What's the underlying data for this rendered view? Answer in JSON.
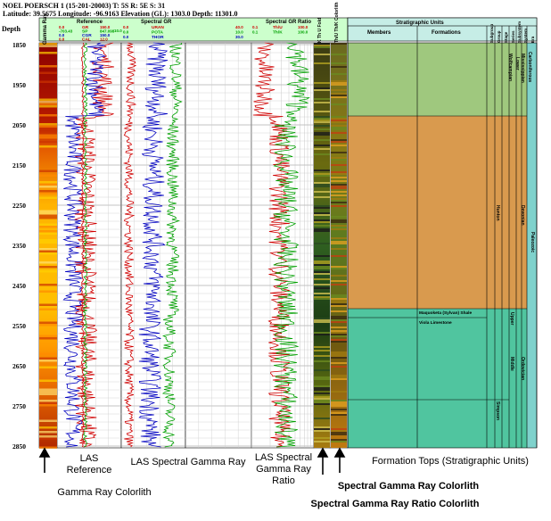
{
  "header": {
    "line1": "NOEL POERSCH 1 (15-201-20003) T: 5S R: 5E S: 31",
    "line2": "Latitude: 39.5675 Longitude: -96.9163 Elevation (GL): 1303.0 Depth: 11301.0"
  },
  "depth": {
    "label": "Depth",
    "ticks": [
      "1850",
      "1950",
      "2050",
      "2150",
      "2250",
      "2350",
      "2450",
      "2550",
      "2650",
      "2750",
      "2850"
    ]
  },
  "tracks": {
    "gr_colorlith": {
      "title": "Gamma Ray"
    },
    "reference": {
      "title": "Reference",
      "curves": [
        {
          "name": "GR",
          "min": "0.0",
          "max": "150.0",
          "color": "#d00000"
        },
        {
          "name": "SP",
          "min": "-703.43",
          "max": "847.098",
          "color": "#00a000"
        },
        {
          "name": "CGR",
          "min": "0.0",
          "max": "150.0",
          "color": "#0000c0"
        },
        {
          "name": "CAL",
          "min": "0.0",
          "max": "12.0",
          "color": "#d00000"
        }
      ],
      "extra_left": "10.0",
      "extra_right": "10.0"
    },
    "spectral_gr": {
      "title": "Spectral GR",
      "curves": [
        {
          "name": "URAN",
          "min": "0.0",
          "max": "40.0",
          "color": "#d00000"
        },
        {
          "name": "POTA",
          "min": "0.0",
          "max": "10.0",
          "color": "#00a000"
        },
        {
          "name": "THOR",
          "min": "0.0",
          "max": "30.0",
          "color": "#0000c0"
        }
      ]
    },
    "gr_ratio": {
      "title": "Spectral GR Ratio",
      "curves": [
        {
          "name": "Th/U",
          "min": "0.1",
          "max": "100.0",
          "color": "#d00000"
        },
        {
          "name": "Th/K",
          "min": "0.1",
          "max": "100.0",
          "color": "#00a000"
        }
      ]
    },
    "spectral_colorlith": {
      "title": "K Th U Fold"
    },
    "ratio_colorlith": {
      "title": "Th/U Th/K Colorlith"
    }
  },
  "strat": {
    "title": "Stratigraphic Units",
    "columns": [
      "Members",
      "Formations",
      "Subgroup",
      "Group",
      "Stage",
      "Series",
      "Subsystem",
      "System",
      "Era"
    ],
    "units": [
      {
        "name": "Wolfcampian",
        "col": "series"
      },
      {
        "name": "Lower",
        "col": "subsystem"
      },
      {
        "name": "Mississippian",
        "col": "system"
      },
      {
        "name": "Carboniferous",
        "col": "system2"
      },
      {
        "name": "Hunton",
        "col": "group"
      },
      {
        "name": "Devonian",
        "col": "system"
      },
      {
        "name": "Paleozoic",
        "col": "era"
      },
      {
        "name": "Maquoketa (Sylvan) Shale",
        "col": "formation"
      },
      {
        "name": "Viola Limestone",
        "col": "formation"
      },
      {
        "name": "Upper",
        "col": "series"
      },
      {
        "name": "Ordovician",
        "col": "system"
      },
      {
        "name": "Middle",
        "col": "series"
      },
      {
        "name": "Simpson",
        "col": "group"
      }
    ]
  },
  "captions": {
    "gr_colorlith": "Gamma Ray Colorlith",
    "las_reference": "LAS\nReference",
    "las_spectral": "LAS Spectral  Gamma Ray",
    "las_ratio": "LAS Spectral\nGamma Ray\nRatio",
    "spectral_colorlith": "Spectral Gamma Ray Colorlith",
    "ratio_colorlith": "Spectral Gamma Ray Ratio Colorlith",
    "formation_tops": "Formation Tops (Stratigraphic  Units)"
  },
  "colors": {
    "header_green": "#ccffcc",
    "strat_header": "#c6ede6",
    "strat_upper": "#9fc87e",
    "strat_devonian": "#d99a4e",
    "strat_ordovician": "#50c59f",
    "teal_col": "#7fd2cc"
  }
}
